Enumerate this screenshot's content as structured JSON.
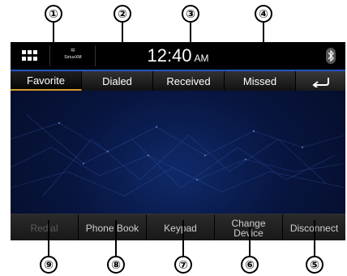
{
  "callouts": {
    "top": [
      "①",
      "②",
      "③",
      "④"
    ],
    "bottom": [
      "⑨",
      "⑧",
      "⑦",
      "⑥",
      "⑤"
    ]
  },
  "status_bar": {
    "time": "12:40",
    "ampm": "AM",
    "siriusxm_label": "SiriusXM",
    "icons": [
      "apps-grid-icon",
      "siriusxm-icon",
      "bluetooth-icon"
    ]
  },
  "tabs": [
    {
      "label": "Favorite",
      "active": true
    },
    {
      "label": "Dialed",
      "active": false
    },
    {
      "label": "Received",
      "active": false
    },
    {
      "label": "Missed",
      "active": false
    }
  ],
  "back_icon": "back-arrow-icon",
  "bottom_buttons": {
    "redial": "Redial",
    "phone_book": "Phone Book",
    "keypad": "Keypad",
    "change_device_line1": "Change",
    "change_device_line2": "Device",
    "disconnect": "Disconnect"
  },
  "colors": {
    "accent_underline": "#d69a2c",
    "status_line": "#2553c9",
    "background": "#081540"
  }
}
